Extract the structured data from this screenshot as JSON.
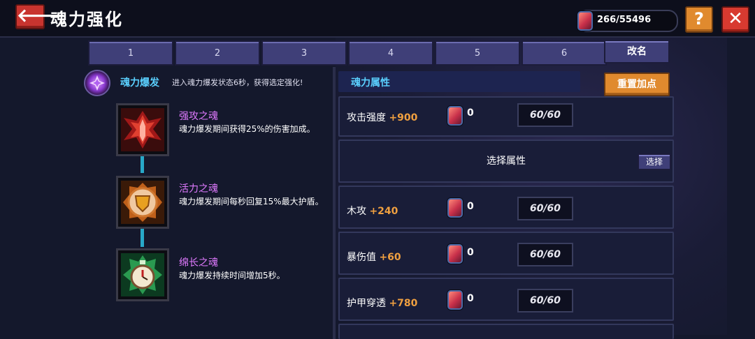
{
  "header": {
    "back_label": "🡐",
    "title": "魂力强化",
    "currency": "266/55496",
    "help_label": "?",
    "close_label": "✕"
  },
  "tabs": [
    "1",
    "2",
    "3",
    "4",
    "5",
    "6"
  ],
  "rename_label": "改名",
  "burst": {
    "title": "魂力爆发",
    "desc": "进入魂力爆发状态6秒，获得选定强化!"
  },
  "skills": [
    {
      "name": "强攻之魂",
      "desc": "魂力爆发期间获得25%的伤害加成。",
      "icon": "red-crystal-icon"
    },
    {
      "name": "活力之魂",
      "desc": "魂力爆发期间每秒回复15%最大护盾。",
      "icon": "shield-emblem-icon"
    },
    {
      "name": "绵长之魂",
      "desc": "魂力爆发持续时间增加5秒。",
      "icon": "stopwatch-icon"
    }
  ],
  "attributes": {
    "header": "魂力属性",
    "reset_label": "重置加点",
    "select_prompt": "选择属性",
    "select_label": "选择",
    "rows": [
      {
        "name": "攻击强度",
        "bonus": "+900",
        "count": "0",
        "level": "60/60"
      },
      {
        "name": "木攻",
        "bonus": "+240",
        "count": "0",
        "level": "60/60"
      },
      {
        "name": "暴伤值",
        "bonus": "+60",
        "count": "0",
        "level": "60/60"
      },
      {
        "name": "护甲穿透",
        "bonus": "+780",
        "count": "0",
        "level": "60/60"
      }
    ]
  },
  "colors": {
    "accent_orange": "#e08a2e",
    "close_red": "#d83a30",
    "tab_purple": "#3f3f78",
    "cyan_heading": "#5ad0ff",
    "skill_name_purple": "#e07aff",
    "bonus_orange": "#f0a040"
  }
}
